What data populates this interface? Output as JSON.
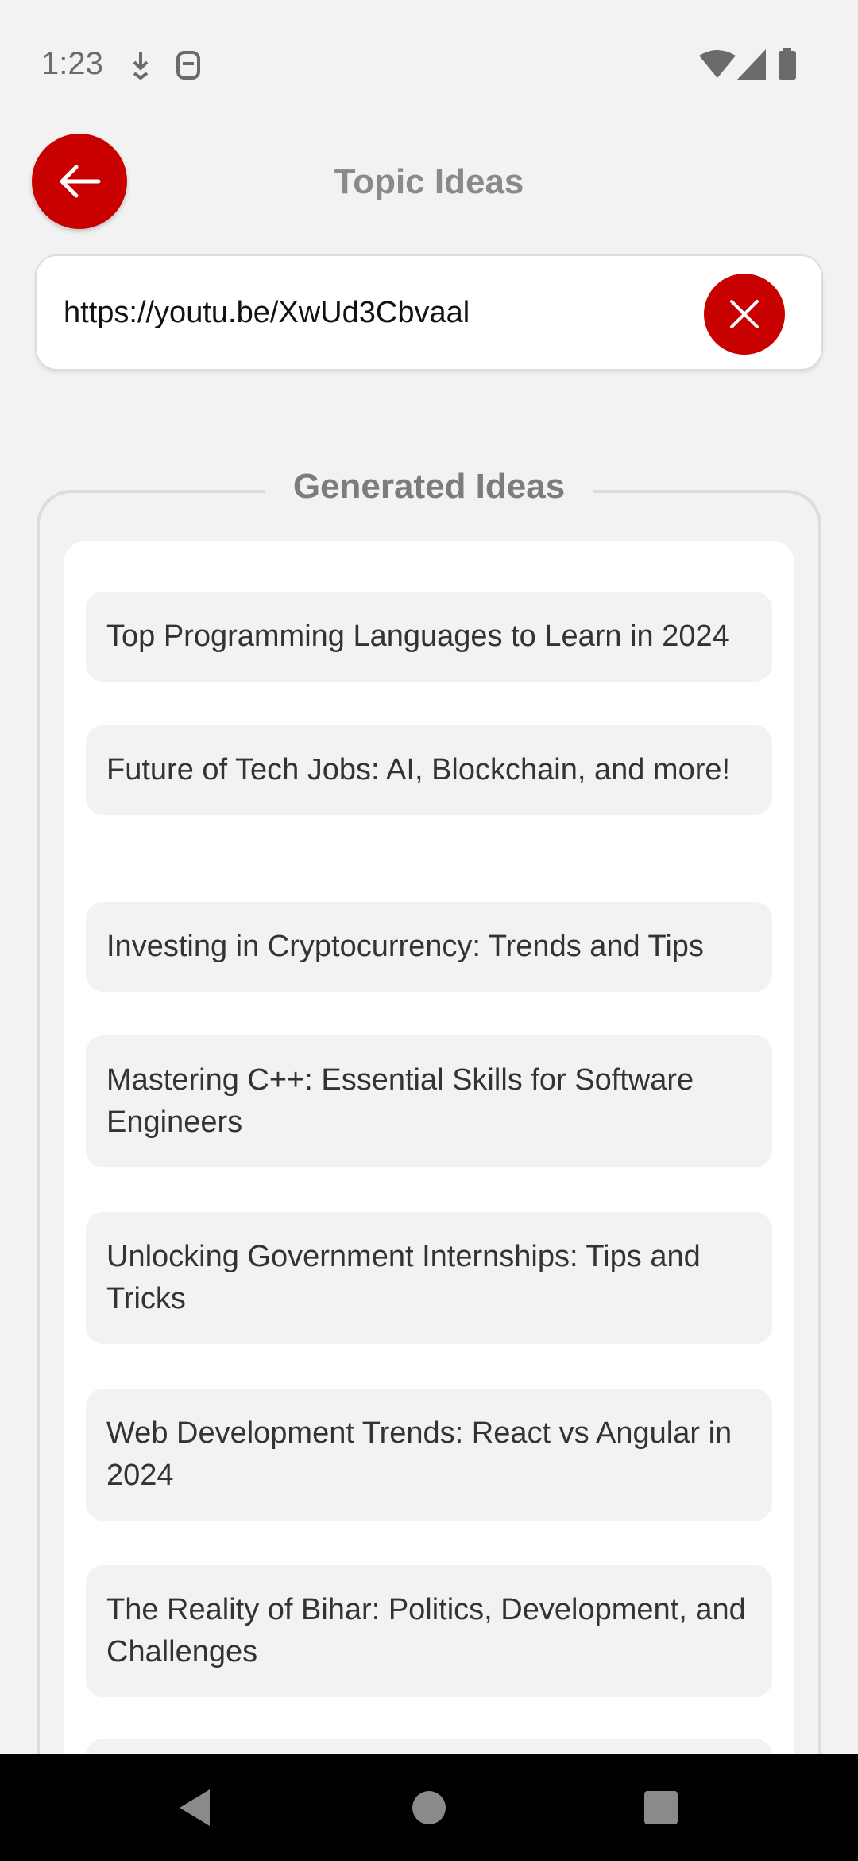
{
  "status_bar": {
    "time": "1:23",
    "left_icons": [
      "download-icon",
      "sim-icon"
    ],
    "right_icons": [
      "wifi-icon",
      "signal-icon",
      "battery-icon"
    ]
  },
  "header": {
    "title": "Topic Ideas",
    "back_icon": "arrow-left-icon"
  },
  "url_input": {
    "value": "https://youtu.be/XwUd3Cbvaal",
    "clear_icon": "close-icon"
  },
  "ideas": {
    "legend": "Generated Ideas",
    "items": [
      "Top Programming Languages to Learn in 2024",
      "Future of Tech Jobs: AI, Blockchain, and more!",
      "Investing in Cryptocurrency: Trends and Tips",
      "Mastering C++: Essential Skills for Software Engineers",
      "Unlocking Government Internships: Tips and Tricks",
      "Web Development Trends: React vs Angular in 2024",
      "The Reality of Bihar: Politics, Development, and Challenges"
    ]
  },
  "nav_bar": {
    "buttons": [
      "back-triangle-icon",
      "home-circle-icon",
      "recents-square-icon"
    ]
  },
  "colors": {
    "accent": "#c80000",
    "background": "#f2f2f2",
    "card": "#ffffff",
    "title_gray": "#8a8a8a"
  }
}
